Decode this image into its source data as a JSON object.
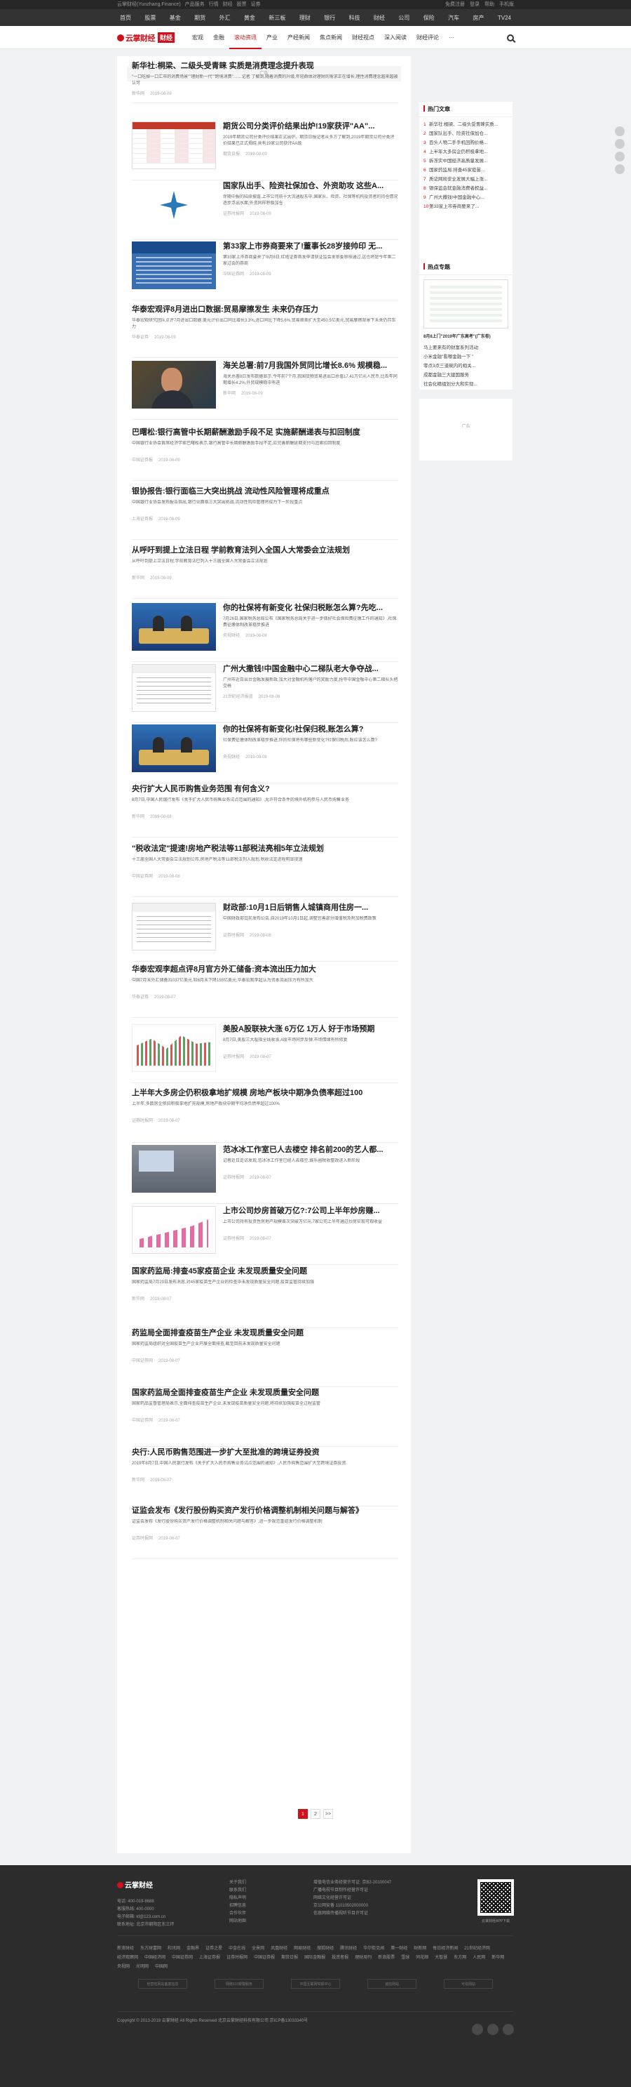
{
  "topbar": {
    "left": [
      "云掌财经(Yunzhang.Finance)",
      "产品服务",
      "行情",
      "财经",
      "股票",
      "证券"
    ],
    "right": [
      "免费注册",
      "登录",
      "帮助",
      "手机版"
    ]
  },
  "channels": [
    "首页",
    "股票",
    "基金",
    "期货",
    "外汇",
    "黄金",
    "新三板",
    "理财",
    "银行",
    "科技",
    "财经",
    "公司",
    "保险",
    "汽车",
    "房产",
    "TV24"
  ],
  "header": {
    "brand": "云掌财经",
    "sub": "财经",
    "nav": [
      "宏观",
      "金融",
      "滚动资讯",
      "产业",
      "产经新闻",
      "焦点新闻",
      "财经视点",
      "深入阅读",
      "财经评论",
      "···"
    ],
    "active_index": 2
  },
  "ad_top": "广告",
  "articles": [
    {
      "title": "新华社:桐梁、二级头受青睐 实质是消费理念提升表现",
      "desc": "\"一口吃掉一口汇市的消费场景\"\"理财新一代\"\"跨境消费\"……记者 了解到,随着消费的升级,年轻群体对理财的需求正在增长,理性消费理念越来越被认可",
      "source": "新华网",
      "date": "2019-08-09"
    },
    {
      "title": "期货公司分类评价结果出炉!19家获评\"AA\"...",
      "desc": "2019年期货公司分类评价结果正式出炉。期货日报记者从多方了解到,2019年期货公司分类评价结果已正式揭晓,共有19家公司获评AA级",
      "source": "期货日报",
      "date": "2019-08-09"
    },
    {
      "title": "国家队出手、险资社保加仓、外资助攻 这些A...",
      "desc": "伴随中报的陆续披露,上市公司前十大流通股东中,国家队、险资、社保等机构投资者的持仓情况逐步浮出水面,外资同样积极加仓",
      "source": "证券时报网",
      "date": "2019-08-09"
    },
    {
      "title": "第33家上市券商要来了!董事长28岁接帅印 无...",
      "desc": "第33家上市券商要来了!8月8日,红塔证券首发申请获证监会发审委审核通过,这也将是今年第二家过会的券商",
      "source": "中国证券网",
      "date": "2019-08-09"
    },
    {
      "title": "华泰宏观评8月进出口数据:贸易摩擦发生 未来仍存压力",
      "desc": "华泰宏观研究团队点评7月进出口数据:美元计价出口同比增长3.3%,进口同比下降5.6%,贸易顺差扩大至450.5亿美元,贸易摩擦背景下未来仍存压力",
      "source": "华泰证券",
      "date": "2019-08-09"
    },
    {
      "title": "海关总署:前7月我国外贸同比增长8.6% 规模稳...",
      "desc": "海关总署8日发布数据显示,今年前7个月,我国货物贸易进出口总值17.41万亿元人民币,比去年同期增长4.2%,外贸规模稳中有进",
      "source": "新华网",
      "date": "2019-08-09"
    },
    {
      "title": "巴曙松:银行高管中长期薪酬激励手段不足 实施薪酬递表与扣回制度",
      "desc": "中国银行业协会首席经济学家巴曙松表示,银行高管中长期薪酬激励手段不足,应完善薪酬延期支付与追索扣回制度",
      "source": "中国证券报",
      "date": "2019-08-09"
    },
    {
      "title": "银协报告:银行面临三大突出挑战 流动性风险管理将成重点",
      "desc": "中国银行业协会发布报告指出,银行业面临三大突出挑战,流动性风险管理将成为下一阶段重点",
      "source": "上海证券报",
      "date": "2019-08-09"
    },
    {
      "title": "从呼吁到提上立法日程 学前教育法列入全国人大常委会立法规划",
      "desc": "从呼吁到提上立法日程,学前教育法已列入十三届全国人大常委会立法规划",
      "source": "新华网",
      "date": "2019-08-09"
    },
    {
      "title": "你的社保将有新变化 社保归税账怎么算?先吃...",
      "desc": "7月26日,国家税务总局公布《国家税务总局关于进一步做好社会保险费征缴工作的通知》,社保费征缴体制改革稳步推进",
      "source": "央视财经",
      "date": "2019-08-08"
    },
    {
      "title": "广州大撒钱!中国金融中心二梯队老大争夺战...",
      "desc": "广州市近日出台金融发展新政,加大对金融机构落户的奖励力度,抢夺中国金融中心第二梯队头把交椅",
      "source": "21世纪经济报道",
      "date": "2019-08-08"
    },
    {
      "title": "你的社保将有新变化!社保归税,账怎么算?",
      "desc": "社保费征缴体制改革稳步推进,你的社保将有哪些新变化?社保归税后,账应该怎么算?",
      "source": "央视财经",
      "date": "2019-08-08"
    },
    {
      "title": "央行扩大人民币购售业务范围 有何含义?",
      "desc": "8月7日,中国人民银行发布《关于扩大人民币购售业务试点范围的通知》,允许符合条件的境外机构参与人民币购售业务",
      "source": "新华网",
      "date": "2019-08-08"
    },
    {
      "title": "\"税收法定\"提速!房地产税法等11部税法亮相5年立法规划",
      "desc": "十三届全国人大常委会立法规划公布,房地产税法等11部税法列入规划,税收法定进程明显提速",
      "source": "中国证券网",
      "date": "2019-08-08"
    },
    {
      "title": "财政部:10月1日后销售人城镇商用住房一...",
      "desc": "中国财政部日前发布公告,自2019年10月1日起,调整完善部分增值税及附加税费政策",
      "source": "证券时报网",
      "date": "2019-08-08"
    },
    {
      "title": "华泰宏观李超点评8月官方外汇储备:资本流出压力加大",
      "desc": "中国7月末外汇储备31037亿美元,较6月末下降155亿美元,华泰宏观李超认为资本流出压力有所加大",
      "source": "华泰证券",
      "date": "2019-08-07"
    },
    {
      "title": "美股A股联袂大涨 6万亿 1万人 好于市场预期",
      "desc": "8月7日,美股三大股指全线收涨,A股市场同步反弹,市场情绪有所修复",
      "source": "证券时报网",
      "date": "2019-08-07"
    },
    {
      "title": "上半年大多房企仍积极拿地扩规模 房地产板块中期净负债率超过100",
      "desc": "上半年,多数房企依旧积极拿地扩充规模,房地产板块中期平均净负债率超过100%",
      "source": "证券时报网",
      "date": "2019-08-07"
    },
    {
      "title": "范冰冰工作室已人去楼空 排名前200的艺人都...",
      "desc": "记者近日走访发现,范冰冰工作室已经人去楼空,娱乐圈税收整改进入新阶段",
      "source": "证券时报网",
      "date": "2019-08-07"
    },
    {
      "title": "上市公司炒房首破万亿?:7公司上半年炒房赚...",
      "desc": "上市公司持有投资性房地产规模首次突破万亿元,7家公司上半年通过炒房实现可观收益",
      "source": "证券时报网",
      "date": "2019-08-07"
    },
    {
      "title": "国家药监局:排查45家疫苗企业 未发现质量安全问题",
      "desc": "国家药监局7月29日发布消息,对45家疫苗生产企业的检查中未发现质量安全问题,疫苗监管持续加强",
      "source": "新华网",
      "date": "2019-08-07"
    },
    {
      "title": "药监局全面排查疫苗生产企业 未发现质量安全问题",
      "desc": "国家药监局组织对全国疫苗生产企业开展全面排查,截至目前未发现质量安全问题",
      "source": "中国证券网",
      "date": "2019-08-07"
    },
    {
      "title": "国家药监局全面排查疫苗生产企业 未发现质量安全问题",
      "desc": "国家药品监督管理局表示,全面排查疫苗生产企业,未发现疫苗质量安全问题,将持续加强疫苗全过程监管",
      "source": "中国证券网",
      "date": "2019-08-07"
    },
    {
      "title": "央行:人民币购售范围进一步扩大至批准的跨境证券投资",
      "desc": "2019年8月7日,中国人民银行发布《关于扩大人民币购售业务试点范围的通知》,人民币购售范围扩大至跨境证券投资",
      "source": "新华网",
      "date": "2019-08-07"
    },
    {
      "title": "证监会发布《发行股份购买资产发行价格调整机制相关问题与解答》",
      "desc": "证监会发布《发行股份购买资产发行价格调整机制相关问题与解答》,进一步规范重组发行价格调整机制",
      "source": "证券时报网",
      "date": "2019-08-07"
    }
  ],
  "pager": {
    "pages": [
      "1",
      "2"
    ],
    "next": ">>",
    "current": "1"
  },
  "sidebar": {
    "hot_title": "热门文章",
    "hot": [
      "新华社:桐梁、二级头受青睐实质...",
      "国家队出手、险资社保加仓...",
      "百头人物二手手机回购价格...",
      "上半年大多房企仍积极拿地...",
      "拆冻实中国经济高质量发展...",
      "国家药监局:排查45家疫苗...",
      "质证网局安全发展大幅上涨...",
      "银保监会就金融消费者权益...",
      "广州大撒钱!中国金融中心...",
      "第33家上市券商要来了..."
    ],
    "pic_title": "热点专题",
    "pic_caption": "8月8上门\"2019年广东高考\"(广东卷)",
    "pic_list": [
      "马上要来有的财富系列活动",
      "小米金融\"看哪金融一下 \"",
      "零点3点三道碗内的相关...",
      "成都金融三大建国服务",
      "社会化精组划分大和实现..."
    ],
    "ad": "广告"
  },
  "footer": {
    "brand": "云掌财经",
    "contact": [
      "电话: 400-019-8688",
      "客服热线: 400-0000",
      "电子邮箱: kf@123.com.cn",
      "联系地址: 北京市朝阳区东三环"
    ],
    "links_col": [
      "关于我们",
      "联系我们",
      "隐私声明",
      "招聘信息",
      "合作伙伴",
      "网站地图"
    ],
    "info_col": [
      "增值电信业务经营许可证: 京B2-20100047",
      "广播电视节目制作经营许可证",
      "网络文化经营许可证",
      "京公网安备 11010502000000",
      "信息网络传播视听节目许可证"
    ],
    "qr_caption": "云掌财经APP下载",
    "friend_links": [
      "新浪财经",
      "东方财富网",
      "和讯网",
      "金融界",
      "证券之星",
      "中金在线",
      "全景网",
      "凤凰财经",
      "网易财经",
      "搜狐财经",
      "腾讯财经",
      "华尔街见闻",
      "第一财经",
      "财新网",
      "每日经济新闻",
      "21世纪经济网",
      "经济观察网",
      "中国经济网",
      "中国证券网",
      "上海证券报",
      "证券时报网",
      "中国证券报",
      "期货日报",
      "国际金融报",
      "投资者报",
      "理财周刊",
      "新浪股票",
      "雪球",
      "同花顺",
      "大智慧",
      "东方网",
      "人民网",
      "新华网",
      "央视网",
      "光明网",
      "中国网"
    ],
    "badges": [
      "经营性网站备案信息",
      "网络110报警服务",
      "中国互联网举报中心",
      "诚信网站",
      "可信网站"
    ],
    "copyright": "Copyright © 2013-2019 云掌财经 All Rights Reserved 北京云掌财经科技有限公司 京ICP备13033340号"
  }
}
